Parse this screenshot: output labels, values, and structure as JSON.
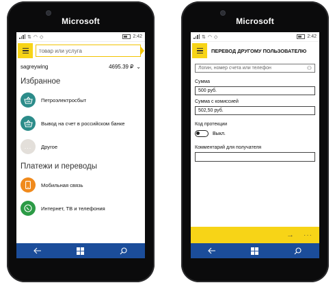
{
  "device": {
    "brand": "Microsoft",
    "time": "2:42"
  },
  "left": {
    "search": {
      "placeholder": "товар или услуга"
    },
    "account": {
      "username": "sagreywing",
      "balance": "4695.39 ₽"
    },
    "favorites": {
      "title": "Избранное",
      "items": [
        {
          "label": "Петроэлектросбыт",
          "icon": "basket-icon",
          "color": "#2c8c8a"
        },
        {
          "label": "Вывод на счет в российском банке",
          "icon": "basket-icon",
          "color": "#2c8c8a"
        },
        {
          "label": "Другое",
          "icon": "more-icon",
          "color": "#e3dfda"
        }
      ]
    },
    "payments": {
      "title": "Платежи и переводы",
      "items": [
        {
          "label": "Мобильная связь",
          "icon": "mobile-icon",
          "color": "#f08a1c"
        },
        {
          "label": "Интернет, ТВ и телефония",
          "icon": "internet-icon",
          "color": "#2c9b46"
        }
      ]
    }
  },
  "right": {
    "title": "ПЕРЕВОД ДРУГОМУ ПОЛЬЗОВАТЕЛЮ",
    "recipient": {
      "placeholder": "Логин, номер счета или телефон"
    },
    "amount": {
      "label": "Сумма",
      "value": "500 руб."
    },
    "amount_fee": {
      "label": "Сумма с комиссией",
      "value": "502,50 руб."
    },
    "protection": {
      "label": "Код протекции",
      "state": "Выкл."
    },
    "comment": {
      "label": "Комментарий для получателя",
      "value": ""
    }
  },
  "colors": {
    "accent": "#f7d417",
    "navbar": "#1b4d9a"
  }
}
